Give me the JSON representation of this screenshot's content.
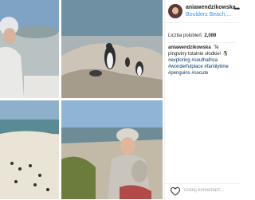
{
  "post": {
    "username": "aniawendzikowska",
    "location": "Boulders Beach,...",
    "likes_label": "Liczba polubień:",
    "likes_count": "2,089",
    "caption_username": "aniawendzikowska",
    "caption_text": "Te pingwiny totalnie słodkie! 🐧",
    "hashtags": [
      "#exploring",
      "#southafrica",
      "#wonderfulplace",
      "#familytime",
      "#penguins",
      "#socute"
    ],
    "comment_placeholder": "Dodaj komentarz..."
  },
  "icons": {
    "more": "more-options-icon",
    "like": "heart-icon"
  },
  "colors": {
    "link": "#3897f0",
    "hashtag": "#003569",
    "text": "#262626",
    "muted": "#a5a7aa"
  }
}
